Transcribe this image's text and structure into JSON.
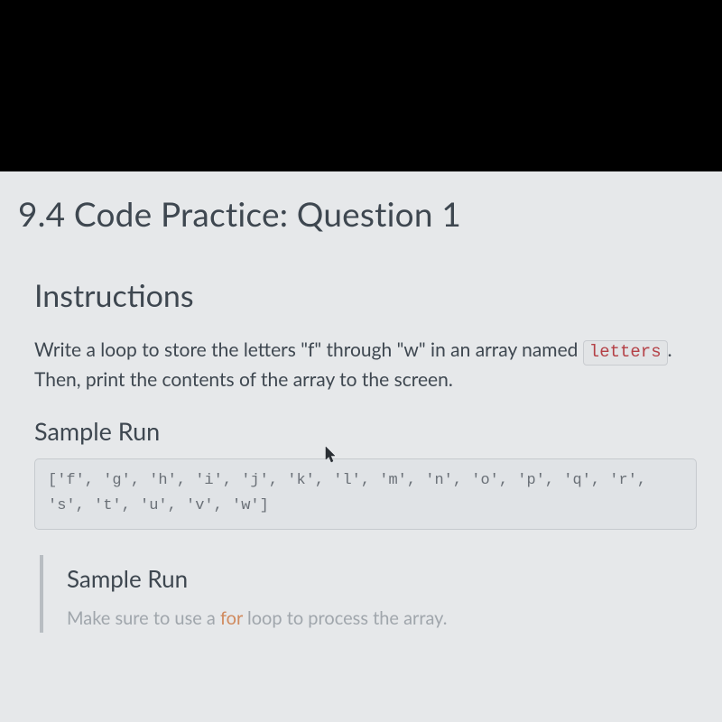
{
  "title": "9.4 Code Practice: Question 1",
  "instructions": {
    "heading": "Instructions",
    "line1_pre": "Write a loop to store the letters \"f\" through \"w\" in an array named ",
    "code_token": "letters",
    "line1_post": ". Then, print the contents of the array to the screen."
  },
  "sample": {
    "heading": "Sample Run",
    "output": "['f', 'g', 'h', 'i', 'j', 'k', 'l', 'm', 'n', 'o', 'p', 'q', 'r', 's', 't', 'u', 'v', 'w']"
  },
  "note": {
    "heading": "Sample Run",
    "pre": "Make sure to use a ",
    "kw": "for",
    "post": " loop to process the array."
  }
}
